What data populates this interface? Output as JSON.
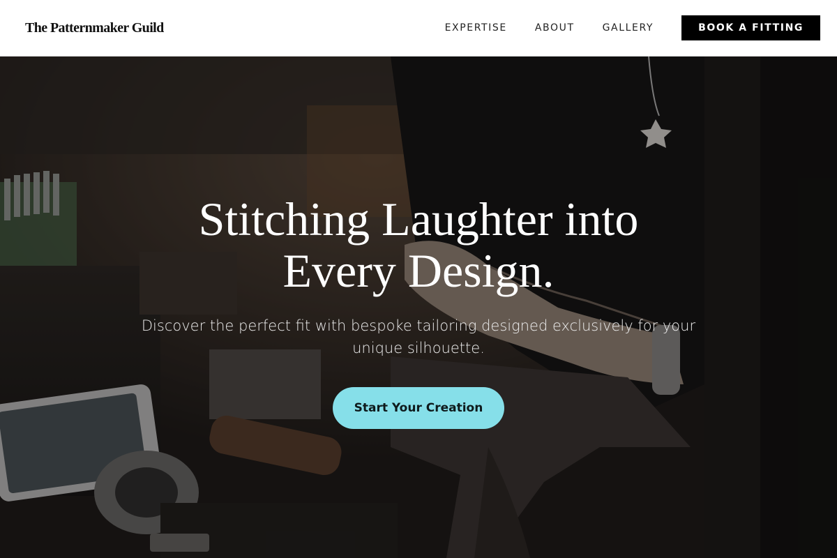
{
  "brand": {
    "name": "The Patternmaker Guild"
  },
  "nav": {
    "links": [
      {
        "label": "EXPERTISE"
      },
      {
        "label": "ABOUT"
      },
      {
        "label": "GALLERY"
      }
    ],
    "cta_label": "BOOK A FITTING"
  },
  "hero": {
    "title_line1": "Stitching Laughter into",
    "title_line2": "Every Design.",
    "subtitle": "Discover the perfect fit with bespoke tailoring designed exclusively for your unique silhouette.",
    "cta_label": "Start Your Creation",
    "background_image": "workshop-hands-tools-photo"
  },
  "colors": {
    "nav_bg": "#ffffff",
    "nav_cta_bg": "#000000",
    "hero_cta_bg": "#86dfe9",
    "hero_text": "#ffffff"
  }
}
